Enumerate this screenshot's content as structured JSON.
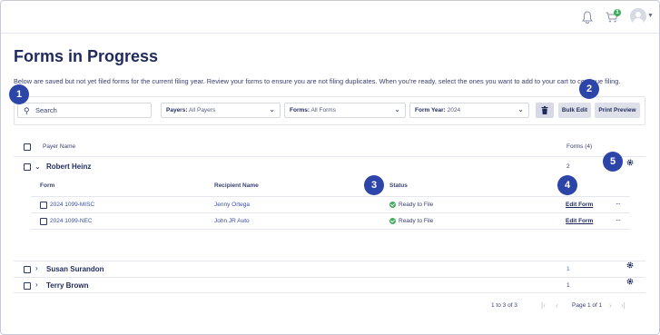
{
  "header": {
    "notifications_icon": "bell-icon",
    "cart_icon": "cart-icon",
    "cart_badge": "1",
    "avatar_icon": "user-avatar-icon"
  },
  "page": {
    "title": "Forms in Progress",
    "description": "Below are saved but not yet filed forms for the current filing year. Review your forms to ensure you are not filing duplicates. When you're ready, select the ones you want to add to your cart to continue filing."
  },
  "filters": {
    "search_placeholder": "Search",
    "payers_label": "Payers:",
    "payers_value": "All Payers",
    "forms_label": "Forms:",
    "forms_value": "All Forms",
    "form_year_label": "Form Year:",
    "form_year_value": "2024",
    "bulk_edit": "Bulk Edit",
    "print_preview": "Print Preview"
  },
  "table": {
    "col_payer": "Payer Name",
    "col_forms": "Forms (4)",
    "rows": [
      {
        "name": "Robert Heinz",
        "count": "2",
        "subtable": {
          "col_form": "Form",
          "col_recipient": "Recipient Name",
          "col_status": "Status",
          "rows": [
            {
              "form": "2024 1099-MISC",
              "recipient": "Jenny Ortega",
              "status": "Ready to File",
              "action": "Edit Form"
            },
            {
              "form": "2024 1099-NEC",
              "recipient": "John JR Auto",
              "status": "Ready to File",
              "action": "Edit Form"
            }
          ]
        }
      },
      {
        "name": "Susan Surandon",
        "count": "1"
      },
      {
        "name": "Terry Brown",
        "count": "1"
      }
    ]
  },
  "pagination": {
    "range": "1 to 3 of 3",
    "page": "Page 1 of 1"
  },
  "markers": [
    "1",
    "2",
    "3",
    "4",
    "5"
  ],
  "colors": {
    "primary": "#1f2a5c",
    "marker": "#2d45a8",
    "success": "#3fae5a"
  }
}
